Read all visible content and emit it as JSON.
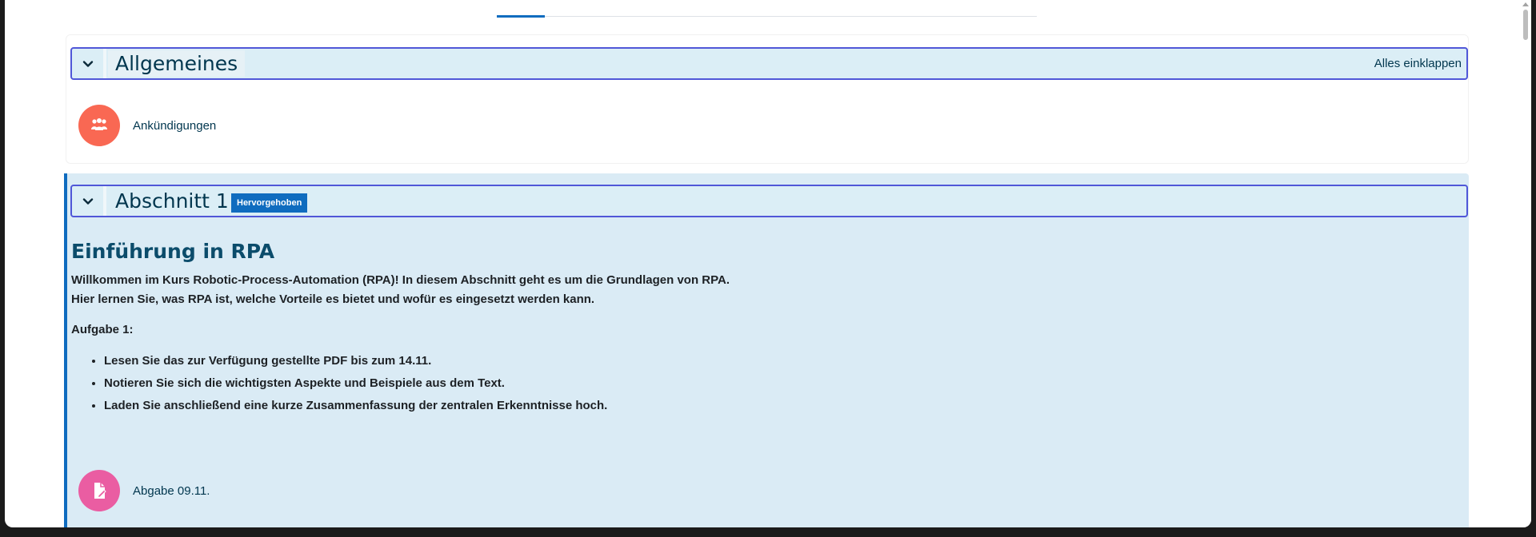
{
  "colors": {
    "accent": "#0f6cbf",
    "section_bg": "#daebf5",
    "header_border": "#5057d8",
    "announcements_icon_bg": "#f96853",
    "assignment_icon_bg": "#ea5da2",
    "title_color": "#00364e"
  },
  "general": {
    "title": "Allgemeines",
    "collapse_all": "Alles einklappen",
    "toggle_icon": "chevron-down-icon",
    "activities": [
      {
        "label": "Ankündigungen",
        "icon": "forum-icon"
      }
    ]
  },
  "section1": {
    "title": "Abschnitt 1",
    "badge": "Hervorgehoben",
    "toggle_icon": "chevron-down-icon",
    "summary": {
      "heading": "Einführung in RPA",
      "intro_line1": "Willkommen im Kurs Robotic-Process-Automation (RPA)! In diesem Abschnitt geht es um die Grundlagen von RPA.",
      "intro_line2": "Hier lernen Sie, was RPA ist, welche Vorteile es bietet und wofür es eingesetzt werden kann.",
      "task_title": "Aufgabe 1:",
      "tasks": [
        "Lesen Sie das zur Verfügung gestellte PDF bis zum 14.11.",
        "Notieren Sie sich die wichtigsten Aspekte und Beispiele aus dem Text.",
        "Laden Sie anschließend eine kurze Zusammenfassung der zentralen Erkenntnisse hoch."
      ]
    },
    "activities": [
      {
        "label": "Abgabe 09.11.",
        "icon": "assignment-icon"
      }
    ]
  }
}
